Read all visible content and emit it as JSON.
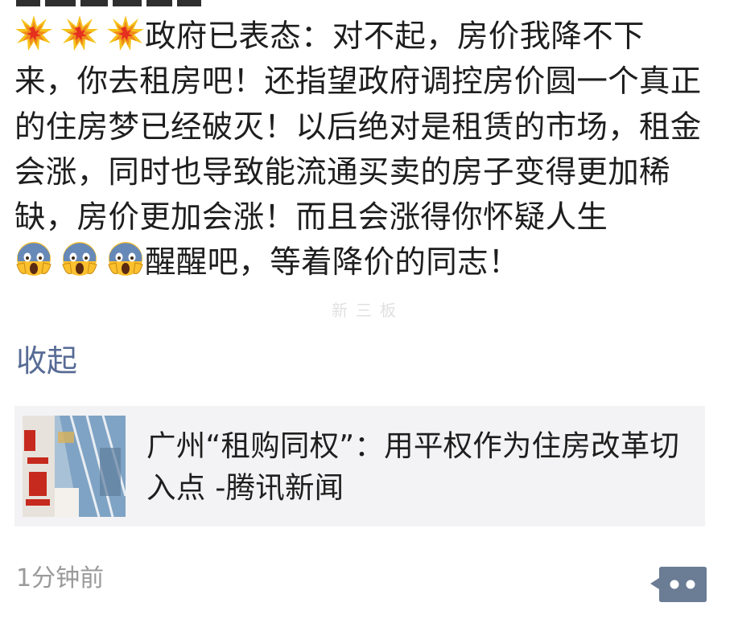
{
  "post": {
    "lead_emojis": [
      "collision-emoji",
      "collision-emoji",
      "collision-emoji"
    ],
    "text_part1": "政府已表态：对不起，房价我降不下来，你去租房吧！还指望政府调控房价圆一个真正的住房梦已经破灭！以后绝对是租赁的市场，租金会涨，同时也导致能流通买卖的房子变得更加稀缺，房价更加会涨！而且会涨得你怀疑人生",
    "mid_emojis": [
      "scream-emoji",
      "scream-emoji",
      "scream-emoji"
    ],
    "text_part2": "醒醒吧，等着降价的同志！",
    "collapse_label": "收起",
    "watermark_text": "新三板"
  },
  "link_card": {
    "thumbnail_icon": "news-thumbnail-image",
    "title": "广州“租购同权”：用平权作为住房改革切入点 -腾讯新闻"
  },
  "footer": {
    "timestamp": "1分钟前",
    "comment_icon": "comment-dots-icon"
  },
  "colors": {
    "body_text": "#1e1e1e",
    "link_blue": "#576b95",
    "card_background": "#f3f3f5",
    "timestamp_gray": "#9a9a9a",
    "comment_button": "#6b7c95"
  }
}
